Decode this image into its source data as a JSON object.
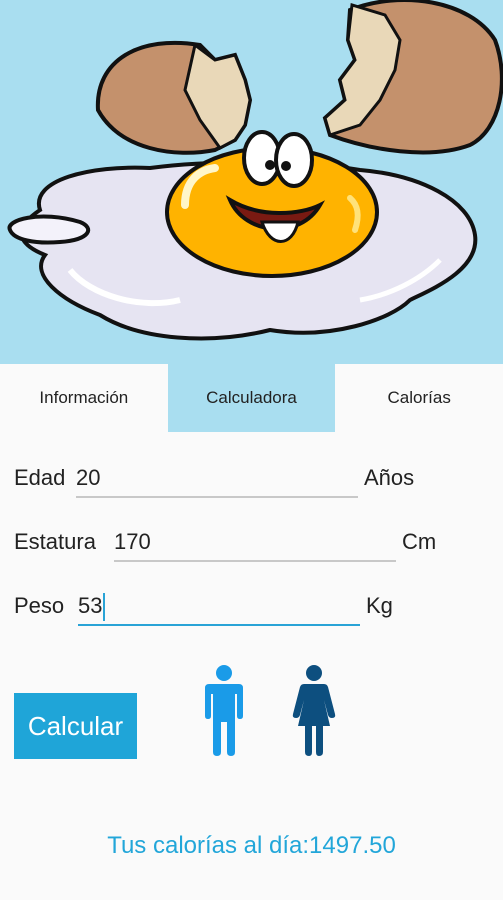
{
  "colors": {
    "accent": "#1fa5d8",
    "hero_bg": "#a9def0",
    "male_icon": "#1a9be8",
    "female_icon": "#0d4f7f",
    "result_text": "#22a6d9"
  },
  "tabs": [
    {
      "label": "Información",
      "active": false
    },
    {
      "label": "Calculadora",
      "active": true
    },
    {
      "label": "Calorías",
      "active": false
    }
  ],
  "form": {
    "edad": {
      "label": "Edad",
      "value": "20",
      "unit": "Años"
    },
    "estatura": {
      "label": "Estatura",
      "value": "170",
      "unit": "Cm"
    },
    "peso": {
      "label": "Peso",
      "value": "53",
      "unit": "Kg"
    }
  },
  "actions": {
    "calculate_label": "Calcular"
  },
  "icons": {
    "male": "male-person-icon",
    "female": "female-person-icon",
    "hero": "cartoon-egg-illustration"
  },
  "result": {
    "text": "Tus calorías al día:1497.50"
  }
}
